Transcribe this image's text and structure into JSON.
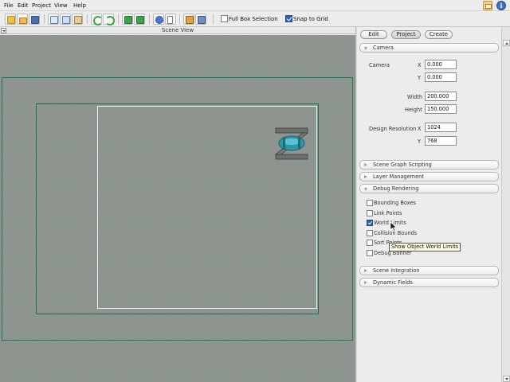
{
  "menu": {
    "items": [
      "File",
      "Edit",
      "Project",
      "View",
      "Help"
    ]
  },
  "toolbar": {
    "buttons": [
      "new-icon",
      "open-folder-icon",
      "save-icon",
      "cut-icon",
      "copy-icon",
      "paste-icon",
      "undo-icon",
      "redo-icon",
      "add-level-icon",
      "add-scene-icon",
      "play-icon",
      "pointer-icon",
      "brush-icon",
      "monitor-icon"
    ],
    "full_box_selection": {
      "label": "Full Box Selection",
      "checked": false
    },
    "snap_to_grid": {
      "label": "Snap to Grid",
      "checked": true
    }
  },
  "scene_view": {
    "title": "Scene View"
  },
  "panel": {
    "tabs": [
      "Edit",
      "Project",
      "Create"
    ],
    "active_tab": "Project",
    "camera_section": {
      "title": "Camera"
    },
    "camera": {
      "label": "Camera",
      "x_label": "X",
      "x_value": "0.000",
      "y_label": "Y",
      "y_value": "0.000",
      "width_label": "Width",
      "width_value": "200.000",
      "height_label": "Height",
      "height_value": "150.000",
      "design_res_label": "Design Resolution",
      "res_x_label": "X",
      "res_x_value": "1024",
      "res_y_label": "Y",
      "res_y_value": "768"
    },
    "sections": {
      "scene_graph": "Scene Graph Scripting",
      "layer_management": "Layer Management",
      "debug_rendering": "Debug Rendering",
      "scene_integration": "Scene Integration",
      "dynamic_fields": "Dynamic Fields"
    },
    "debug": [
      {
        "label": "Bounding Boxes",
        "checked": false
      },
      {
        "label": "Link Points",
        "checked": false
      },
      {
        "label": "World Limits",
        "checked": true
      },
      {
        "label": "Collision Bounds",
        "checked": false
      },
      {
        "label": "Sort Points",
        "checked": false
      },
      {
        "label": "Debug Banner",
        "checked": false
      }
    ],
    "tooltip": "Show Object World Limits"
  },
  "colors": {
    "viewport_bg": "#8f9590",
    "world_limit_outer": "#1d7a5a",
    "camera_rect": "#1f6e50",
    "design_rect": "#f2f2f2",
    "checkbox_on": "#2d5fb4"
  }
}
